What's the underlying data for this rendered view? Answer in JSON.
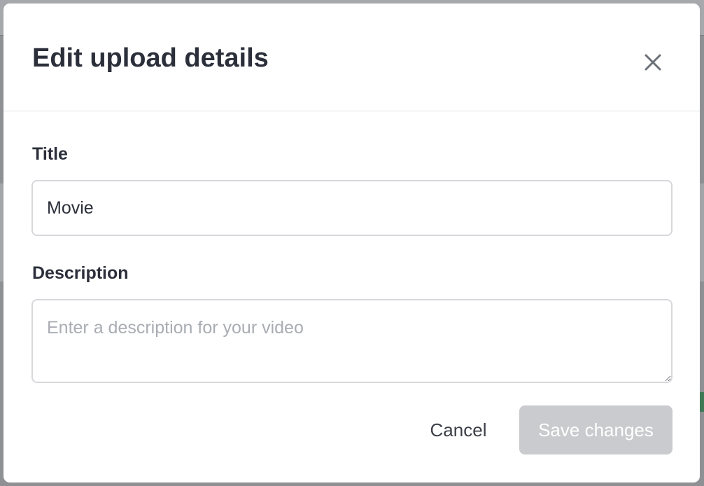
{
  "modal": {
    "title": "Edit upload details",
    "close_icon": "close-icon"
  },
  "form": {
    "title_label": "Title",
    "title_value": "Movie",
    "description_label": "Description",
    "description_value": "",
    "description_placeholder": "Enter a description for your video"
  },
  "footer": {
    "cancel_label": "Cancel",
    "save_label": "Save changes",
    "save_enabled": false
  },
  "colors": {
    "text": "#2b2f3a",
    "border": "#d6d8db",
    "disabled_button": "#c9cbce",
    "placeholder": "#a9adb3"
  }
}
